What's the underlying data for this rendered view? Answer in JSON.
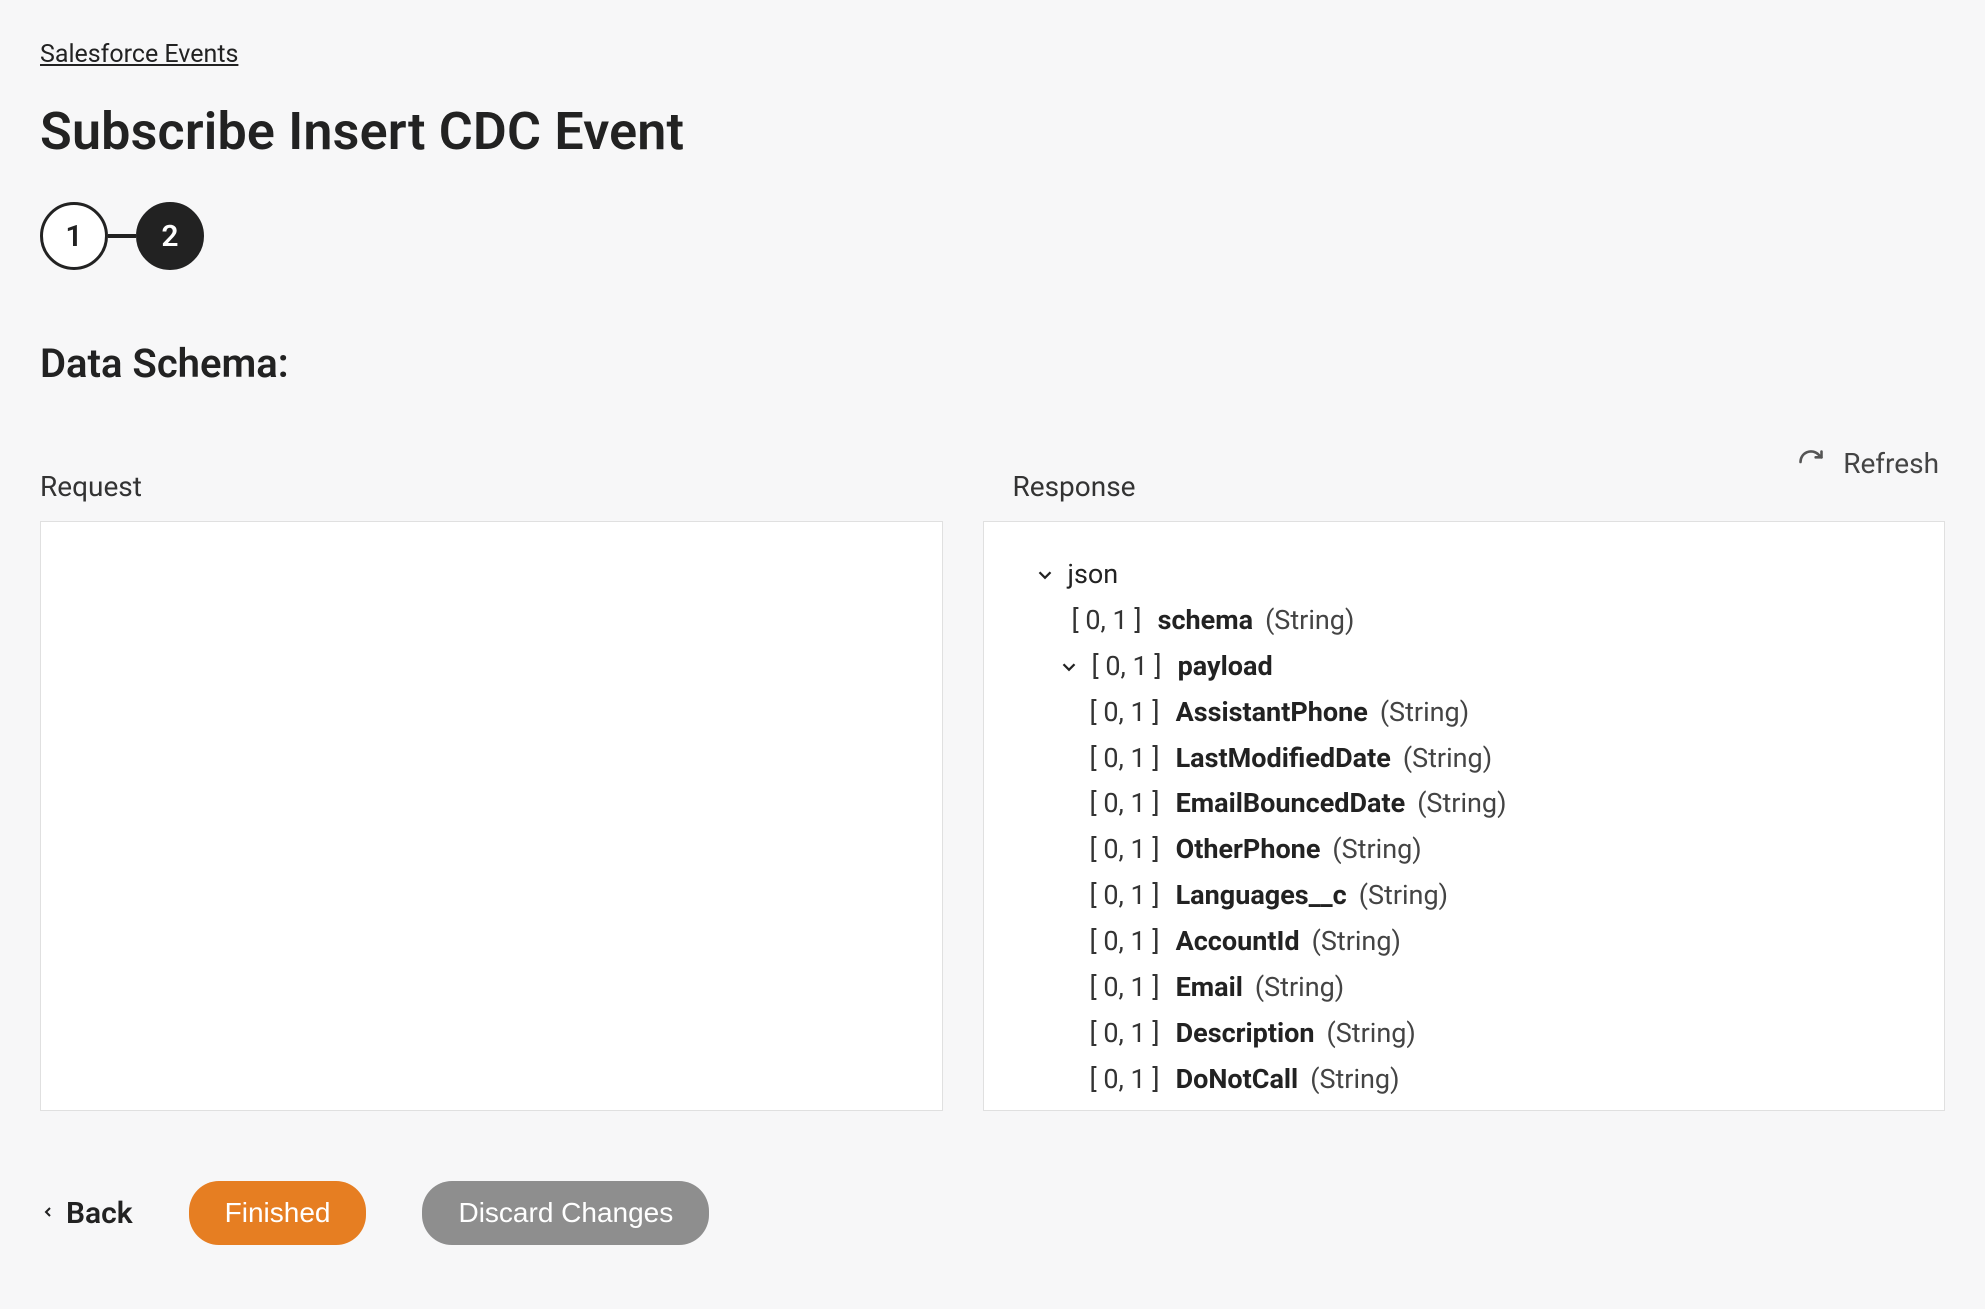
{
  "breadcrumb": "Salesforce Events",
  "title": "Subscribe Insert CDC Event",
  "stepper": {
    "step1": "1",
    "step2": "2"
  },
  "section_label": "Data Schema:",
  "refresh_label": "Refresh",
  "request_label": "Request",
  "response_label": "Response",
  "tree": {
    "root": "json",
    "schema": {
      "card": "[ 0, 1 ]",
      "name": "schema",
      "type": "(String)"
    },
    "payload": {
      "card": "[ 0, 1 ]",
      "name": "payload"
    },
    "fields": [
      {
        "card": "[ 0, 1 ]",
        "name": "AssistantPhone",
        "type": "(String)"
      },
      {
        "card": "[ 0, 1 ]",
        "name": "LastModifiedDate",
        "type": "(String)"
      },
      {
        "card": "[ 0, 1 ]",
        "name": "EmailBouncedDate",
        "type": "(String)"
      },
      {
        "card": "[ 0, 1 ]",
        "name": "OtherPhone",
        "type": "(String)"
      },
      {
        "card": "[ 0, 1 ]",
        "name": "Languages__c",
        "type": "(String)"
      },
      {
        "card": "[ 0, 1 ]",
        "name": "AccountId",
        "type": "(String)"
      },
      {
        "card": "[ 0, 1 ]",
        "name": "Email",
        "type": "(String)"
      },
      {
        "card": "[ 0, 1 ]",
        "name": "Description",
        "type": "(String)"
      },
      {
        "card": "[ 0, 1 ]",
        "name": "DoNotCall",
        "type": "(String)"
      }
    ]
  },
  "footer": {
    "back": "Back",
    "finished": "Finished",
    "discard": "Discard Changes"
  }
}
